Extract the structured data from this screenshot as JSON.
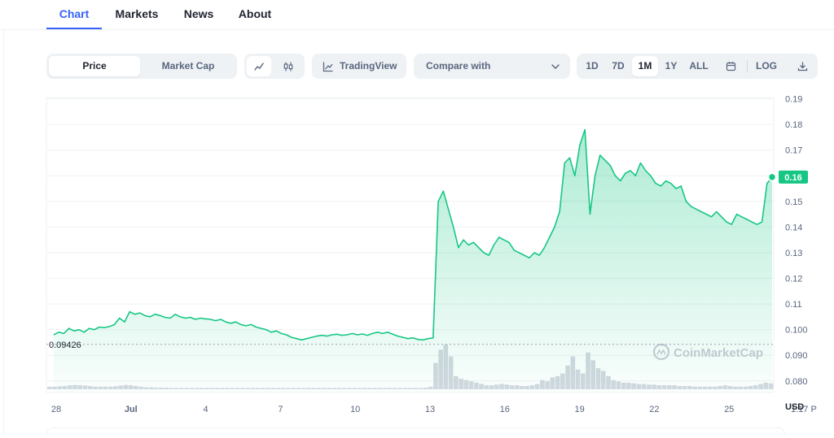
{
  "tabs": [
    {
      "label": "Chart",
      "active": true
    },
    {
      "label": "Markets",
      "active": false
    },
    {
      "label": "News",
      "active": false
    },
    {
      "label": "About",
      "active": false
    }
  ],
  "toolbar": {
    "price_label": "Price",
    "market_cap_label": "Market Cap",
    "line_icon": "line-chart-icon",
    "candle_icon": "candlestick-icon",
    "tradingview_label": "TradingView",
    "compare_label": "Compare with",
    "ranges": [
      "1D",
      "7D",
      "1M",
      "1Y",
      "ALL"
    ],
    "active_range": "1M",
    "calendar_icon": "calendar-icon",
    "log_label": "LOG",
    "download_icon": "download-icon"
  },
  "watermark": "CoinMarketCap",
  "chart_data": {
    "type": "area",
    "y_ticks": [
      "0.19",
      "0.18",
      "0.17",
      "0.16",
      "0.15",
      "0.14",
      "0.13",
      "0.12",
      "0.11",
      "0.100",
      "0.090",
      "0.080"
    ],
    "x_ticks": [
      "28",
      "Jul",
      "4",
      "7",
      "10",
      "13",
      "16",
      "19",
      "22",
      "25",
      "1:17 P"
    ],
    "ylim": [
      0.0755,
      0.1905
    ],
    "open_price_label": "0.09426",
    "open_price": 0.09426,
    "current_price_label": "0.16",
    "current_price": 0.1595,
    "currency_label": "USD",
    "accent_color": "#16c784",
    "series": [
      {
        "values": [
          0.098,
          0.099,
          0.0985,
          0.1005,
          0.0995,
          0.1,
          0.099,
          0.1005,
          0.1,
          0.101,
          0.1008,
          0.1012,
          0.102,
          0.1045,
          0.103,
          0.107,
          0.106,
          0.1065,
          0.1055,
          0.105,
          0.106,
          0.1055,
          0.1048,
          0.1045,
          0.106,
          0.105,
          0.1045,
          0.1048,
          0.104,
          0.1045,
          0.1042,
          0.104,
          0.1035,
          0.104,
          0.103,
          0.1025,
          0.103,
          0.102,
          0.1015,
          0.102,
          0.101,
          0.1005,
          0.1,
          0.099,
          0.0995,
          0.0985,
          0.098,
          0.097,
          0.0965,
          0.096,
          0.0965,
          0.097,
          0.0975,
          0.0978,
          0.0975,
          0.098,
          0.0982,
          0.0978,
          0.098,
          0.0985,
          0.098,
          0.0983,
          0.0978,
          0.0985,
          0.099,
          0.0985,
          0.099,
          0.0982,
          0.0975,
          0.097,
          0.0965,
          0.0968,
          0.0962,
          0.096,
          0.0965,
          0.0968,
          0.15,
          0.154,
          0.147,
          0.14,
          0.132,
          0.135,
          0.133,
          0.134,
          0.132,
          0.13,
          0.129,
          0.133,
          0.136,
          0.135,
          0.134,
          0.131,
          0.13,
          0.129,
          0.128,
          0.13,
          0.129,
          0.132,
          0.136,
          0.14,
          0.146,
          0.165,
          0.167,
          0.16,
          0.172,
          0.178,
          0.145,
          0.16,
          0.168,
          0.166,
          0.164,
          0.16,
          0.158,
          0.161,
          0.162,
          0.16,
          0.165,
          0.162,
          0.16,
          0.157,
          0.156,
          0.158,
          0.157,
          0.155,
          0.156,
          0.15,
          0.148,
          0.147,
          0.146,
          0.145,
          0.144,
          0.146,
          0.144,
          0.142,
          0.141,
          0.145,
          0.144,
          0.143,
          0.142,
          0.141,
          0.142,
          0.157,
          0.1595
        ]
      }
    ],
    "volume_values": [
      0.2,
      0.2,
      0.22,
      0.25,
      0.3,
      0.32,
      0.3,
      0.28,
      0.25,
      0.2,
      0.2,
      0.2,
      0.2,
      0.22,
      0.28,
      0.32,
      0.3,
      0.25,
      0.2,
      0.15,
      0.15,
      0.12,
      0.12,
      0.12,
      0.1,
      0.1,
      0.1,
      0.1,
      0.1,
      0.1,
      0.1,
      0.1,
      0.1,
      0.1,
      0.1,
      0.1,
      0.1,
      0.1,
      0.1,
      0.1,
      0.1,
      0.1,
      0.1,
      0.1,
      0.1,
      0.1,
      0.1,
      0.1,
      0.1,
      0.1,
      0.1,
      0.1,
      0.1,
      0.1,
      0.1,
      0.1,
      0.1,
      0.1,
      0.1,
      0.1,
      0.1,
      0.1,
      0.1,
      0.1,
      0.1,
      0.1,
      0.1,
      0.1,
      0.1,
      0.1,
      0.1,
      0.1,
      0.1,
      0.1,
      0.12,
      0.2,
      2.0,
      3.0,
      3.4,
      2.5,
      1.0,
      0.8,
      0.7,
      0.6,
      0.5,
      0.4,
      0.3,
      0.3,
      0.35,
      0.4,
      0.35,
      0.3,
      0.3,
      0.25,
      0.25,
      0.3,
      0.4,
      0.7,
      0.6,
      0.9,
      1.0,
      1.2,
      1.8,
      2.5,
      1.5,
      1.2,
      2.8,
      2.2,
      1.6,
      1.4,
      1.0,
      0.7,
      0.6,
      0.5,
      0.5,
      0.45,
      0.4,
      0.4,
      0.35,
      0.35,
      0.3,
      0.3,
      0.3,
      0.3,
      0.25,
      0.25,
      0.25,
      0.2,
      0.2,
      0.2,
      0.2,
      0.2,
      0.25,
      0.3,
      0.25,
      0.2,
      0.2,
      0.2,
      0.25,
      0.3,
      0.4,
      0.5,
      0.45
    ]
  }
}
